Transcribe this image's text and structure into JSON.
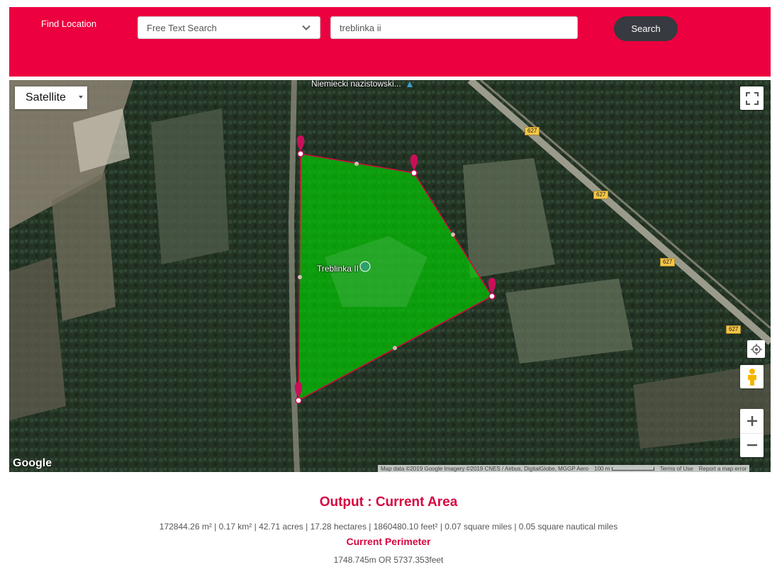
{
  "header": {
    "find_label": "Find Location",
    "search_mode": "Free Text Search",
    "search_value": "treblinka ii",
    "search_button": "Search",
    "bg_color": "#ec003f"
  },
  "map": {
    "type_label": "Satellite",
    "place_top": "Niemiecki nazistowski...",
    "place_center": "Treblinka II",
    "road_shields": [
      "627",
      "627",
      "627",
      "627"
    ],
    "logo": "Google",
    "attribution": "Map data ©2019 Google Imagery ©2019 CNES / Airbus, DigitalGlobe, MGGP Aero",
    "scale_label": "100 m",
    "terms": "Terms of Use",
    "report": "Report a map error",
    "controls": [
      "fullscreen-icon",
      "my-location-icon",
      "pegman-icon",
      "zoom-in-icon",
      "zoom-out-icon"
    ],
    "polygon_color": "#00d400",
    "marker_color": "#c8105a"
  },
  "output": {
    "title": "Output : Current Area",
    "area_text": "172844.26 m² | 0.17 km² | 42.71 acres | 17.28 hectares | 1860480.10 feet² | 0.07 square miles | 0.05 square nautical miles",
    "perimeter_title": "Current Perimeter",
    "perimeter_text": "1748.745m OR 5737.353feet"
  }
}
